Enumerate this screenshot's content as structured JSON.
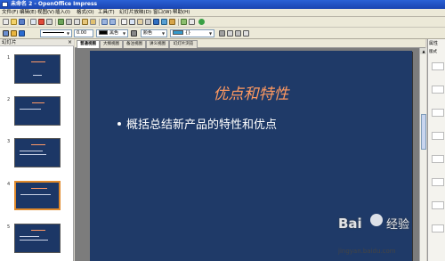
{
  "window": {
    "title": "未命名 2 - OpenOffice Impress"
  },
  "menu": [
    "文件(F)",
    "编辑(E)",
    "视图(V)",
    "插入(I)",
    "格式(O)",
    "工具(T)",
    "幻灯片放映(D)",
    "窗口(W)",
    "帮助(H)"
  ],
  "toolbar2": {
    "line_width": "0.00",
    "line_color_label": "黑色",
    "fill_color_label": "颜色",
    "shadow_label": "{}"
  },
  "slides_panel": {
    "title": "幻灯片",
    "slide_numbers": [
      "1",
      "2",
      "3",
      "4",
      "5"
    ]
  },
  "view_tabs": [
    "普通视图",
    "大纲视图",
    "备注视图",
    "讲义视图",
    "幻灯片浏览"
  ],
  "slide": {
    "title": "优点和特性",
    "bullet": "概括总结新产品的特性和优点"
  },
  "right_pane": {
    "title": "属性",
    "subtitle": "版式"
  },
  "watermark": {
    "brand": "Bai",
    "brand2": "经验",
    "url": "jingyan.baidu.com"
  },
  "colors": {
    "slide_bg": "#1f3a68",
    "title_color": "#ff9960",
    "bullet_color": "#ffffff"
  }
}
